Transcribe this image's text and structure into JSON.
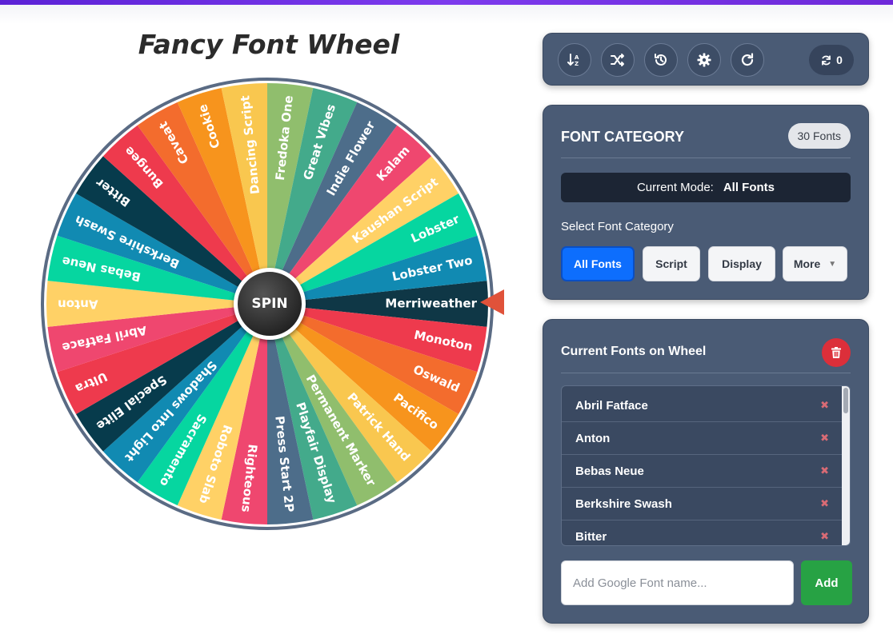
{
  "app": {
    "title": "Fancy Font Wheel",
    "accent_color": "#6d28d9"
  },
  "wheel": {
    "spin_label": "SPIN",
    "pointer_color": "#e0523a",
    "segments": [
      {
        "label": "Merriweather",
        "color": "#0f3746"
      },
      {
        "label": "Monoton",
        "color": "#ee3a4d"
      },
      {
        "label": "Oswald",
        "color": "#f36c2d"
      },
      {
        "label": "Pacifico",
        "color": "#f7941d"
      },
      {
        "label": "Patrick Hand",
        "color": "#f9c74f"
      },
      {
        "label": "Permanent Marker",
        "color": "#90be6d"
      },
      {
        "label": "Playfair Display",
        "color": "#43aa8b"
      },
      {
        "label": "Press Start 2P",
        "color": "#4d6d8a"
      },
      {
        "label": "Righteous",
        "color": "#ef476f"
      },
      {
        "label": "Roboto Slab",
        "color": "#ffd166"
      },
      {
        "label": "Sacramento",
        "color": "#06d6a0"
      },
      {
        "label": "Shadows Into Light",
        "color": "#118ab2"
      },
      {
        "label": "Special Elite",
        "color": "#073b4c"
      },
      {
        "label": "Ultra",
        "color": "#ee3a4d"
      },
      {
        "label": "Abril Fatface",
        "color": "#ef476f"
      },
      {
        "label": "Anton",
        "color": "#ffd166"
      },
      {
        "label": "Bebas Neue",
        "color": "#06d6a0"
      },
      {
        "label": "Berkshire Swash",
        "color": "#118ab2"
      },
      {
        "label": "Bitter",
        "color": "#073b4c"
      },
      {
        "label": "Bungee",
        "color": "#ee3a4d"
      },
      {
        "label": "Caveat",
        "color": "#f36c2d"
      },
      {
        "label": "Cookie",
        "color": "#f7941d"
      },
      {
        "label": "Dancing Script",
        "color": "#f9c74f"
      },
      {
        "label": "Fredoka One",
        "color": "#90be6d"
      },
      {
        "label": "Great Vibes",
        "color": "#43aa8b"
      },
      {
        "label": "Indie Flower",
        "color": "#4d6d8a"
      },
      {
        "label": "Kalam",
        "color": "#ef476f"
      },
      {
        "label": "Kaushan Script",
        "color": "#ffd166"
      },
      {
        "label": "Lobster",
        "color": "#06d6a0"
      },
      {
        "label": "Lobster Two",
        "color": "#118ab2"
      }
    ]
  },
  "toolbar": {
    "buttons": [
      {
        "name": "sort-icon"
      },
      {
        "name": "shuffle-icon"
      },
      {
        "name": "history-icon"
      },
      {
        "name": "gear-icon"
      },
      {
        "name": "reset-icon"
      }
    ],
    "spin_count": "0"
  },
  "category": {
    "heading": "FONT CATEGORY",
    "font_count": "30 Fonts",
    "mode_label": "Current Mode:",
    "mode_value": "All Fonts",
    "select_label": "Select Font Category",
    "buttons": [
      "All Fonts",
      "Script",
      "Display",
      "More"
    ]
  },
  "fonts_panel": {
    "heading": "Current Fonts on Wheel",
    "list": [
      "Abril Fatface",
      "Anton",
      "Bebas Neue",
      "Berkshire Swash",
      "Bitter"
    ],
    "remove_glyph": "✖",
    "input_placeholder": "Add Google Font name...",
    "add_label": "Add"
  }
}
